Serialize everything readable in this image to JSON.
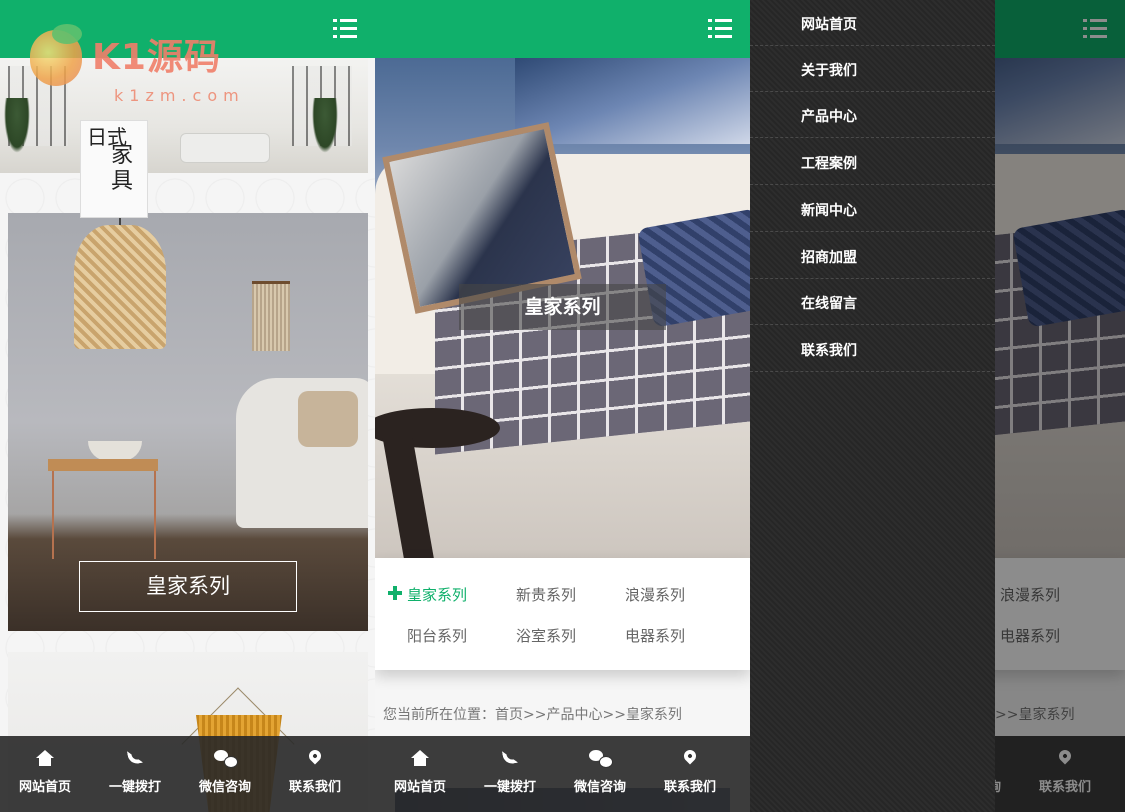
{
  "watermark": {
    "brand": "K1源码",
    "sub": "k1zm.com"
  },
  "banner": {
    "poster_line1": "日式",
    "poster_line2": "家具"
  },
  "panel1": {
    "card_label": "皇家系列"
  },
  "bottom_nav": [
    {
      "label": "网站首页",
      "icon": "home-icon"
    },
    {
      "label": "一键拨打",
      "icon": "phone-icon"
    },
    {
      "label": "微信咨询",
      "icon": "wechat-icon"
    },
    {
      "label": "联系我们",
      "icon": "map-pin-icon"
    }
  ],
  "panel2": {
    "hero_label": "皇家系列",
    "categories": [
      "皇家系列",
      "新贵系列",
      "浪漫系列",
      "阳台系列",
      "浴室系列",
      "电器系列"
    ],
    "active_category": "皇家系列",
    "breadcrumb": {
      "prefix": "您当前所在位置：",
      "home": "首页",
      "sep": ">>",
      "section": "产品中心",
      "current": "皇家系列"
    }
  },
  "drawer": {
    "items": [
      "网站首页",
      "关于我们",
      "产品中心",
      "工程案例",
      "新闻中心",
      "招商加盟",
      "在线留言",
      "联系我们"
    ]
  },
  "colors": {
    "brand_green": "#10b06b",
    "drawer_bg": "#2a2a2a",
    "bottom_bar": "#282828"
  }
}
